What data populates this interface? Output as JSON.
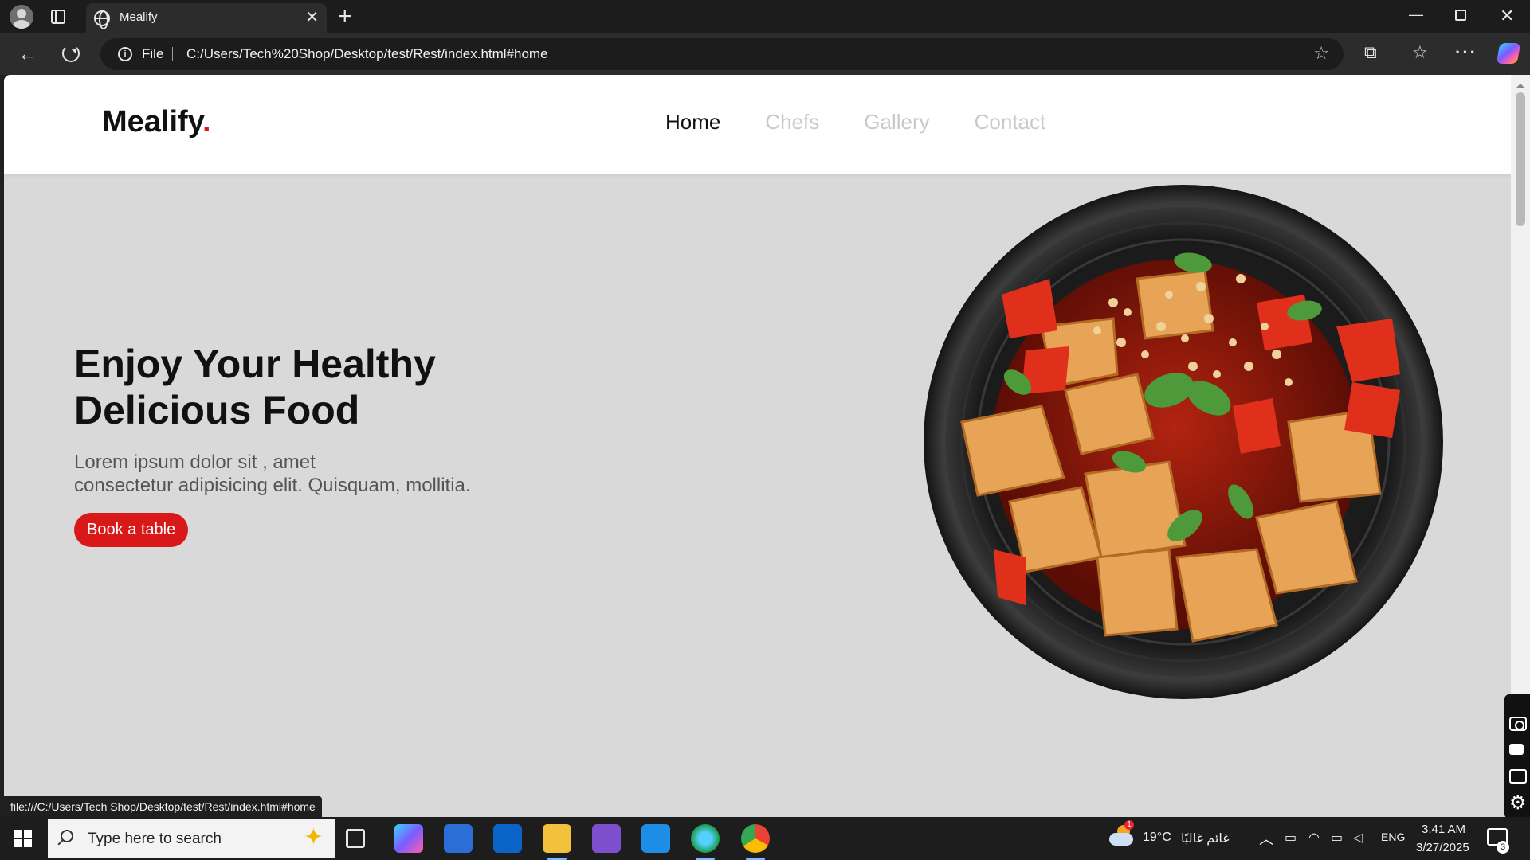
{
  "browser": {
    "tab_title": "Mealify",
    "address_prefix": "File",
    "url": "C:/Users/Tech%20Shop/Desktop/test/Rest/index.html#home",
    "status_url": "file:///C:/Users/Tech Shop/Desktop/test/Rest/index.html#home"
  },
  "site": {
    "logo_text": "Mealify",
    "logo_dot": ".",
    "nav": [
      "Home",
      "Chefs",
      "Gallery",
      "Contact"
    ],
    "active_nav": "Home",
    "hero_title_line1": "Enjoy Your Healthy",
    "hero_title_line2": "Delicious Food",
    "hero_sub_line1": "Lorem ipsum dolor sit , amet",
    "hero_sub_line2": "consectetur adipisicing elit. Quisquam, mollitia.",
    "cta_label": "Book a table",
    "accent_color": "#d91919",
    "hero_background": "#d9d9d9"
  },
  "taskbar": {
    "search_placeholder": "Type here to search",
    "weather_temp": "19°C",
    "weather_desc": "غائم غالبًا",
    "language": "ENG",
    "time": "3:41 AM",
    "date": "3/27/2025",
    "notification_count": "3",
    "weather_badge": "1"
  }
}
